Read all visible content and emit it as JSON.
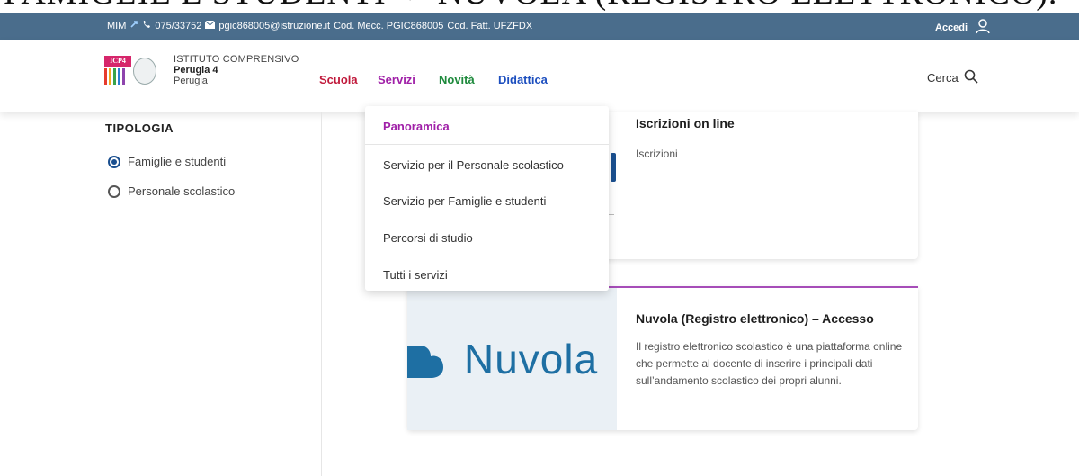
{
  "caption": "FAMIGLIE E STUDENTI -> NUVOLA (REGISTRO ELETTRONICO).",
  "topbar": {
    "contacts_prefix": "MIM",
    "phone": "075/33752",
    "email": "pgic868005@istruzione.it",
    "cod_mecc": "Cod. Mecc. PGIC868005",
    "cod_fatt": "Cod. Fatt. UFZFDX",
    "login_label": "Accedi"
  },
  "header": {
    "logo_badge": "ICP4",
    "school_line1": "ISTITUTO COMPRENSIVO",
    "school_line2": "Perugia 4",
    "school_line3": "Perugia",
    "nav": [
      "Scuola",
      "Servizi",
      "Novità",
      "Didattica"
    ],
    "search_label": "Cerca",
    "colors": {
      "scuola": "#c0183a",
      "servizi": "#a020a8",
      "novita": "#1e8a3c",
      "didattica": "#1d4fbf"
    }
  },
  "sidebar": {
    "title": "TIPOLOGIA",
    "options": [
      {
        "label": "Famiglie e studenti",
        "checked": true
      },
      {
        "label": "Personale scolastico",
        "checked": false
      }
    ]
  },
  "dropdown": {
    "items": [
      "Panoramica",
      "Servizio per il Personale scolastico",
      "Servizio per Famiglie e studenti",
      "Percorsi di studio",
      "Tutti i servizi"
    ]
  },
  "cards": [
    {
      "title": "Iscrizioni on line",
      "category": "Iscrizioni"
    },
    {
      "title": "Nuvola (Registro elettronico) – Accesso",
      "image_word": "Nuvola",
      "description": "Il registro elettronico scolastico è una piattaforma online che permette al docente di inserire i principali dati sull’andamento scolastico dei propri alunni."
    }
  ]
}
